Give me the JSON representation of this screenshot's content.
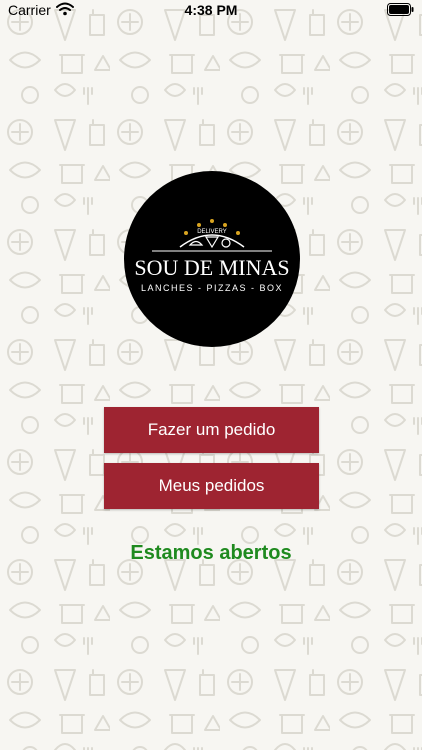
{
  "status_bar": {
    "carrier": "Carrier",
    "time": "4:38 PM",
    "wifi_icon": "wifi-icon",
    "battery_icon": "battery-icon"
  },
  "logo": {
    "top_word": "DELIVERY",
    "name": "SOU DE MINAS",
    "tagline": "LANCHES - PIZZAS - BOX"
  },
  "buttons": {
    "order": "Fazer um pedido",
    "my_orders": "Meus pedidos"
  },
  "status_message": "Estamos abertos",
  "colors": {
    "button": "#9e2431",
    "status_open": "#1f8a1f",
    "background": "#f7f6f2",
    "logo_circle": "#000000"
  }
}
